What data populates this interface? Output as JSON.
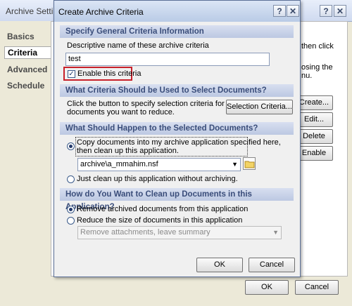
{
  "background_window": {
    "title": "Archive Settin",
    "help_button": "?",
    "close_button": "✕",
    "tabs": [
      "Basics",
      "Criteria",
      "Advanced",
      "Schedule"
    ],
    "snippet_1": "then click",
    "snippet_2": "osing the",
    "snippet_3": "nu.",
    "buttons": {
      "create": "Create...",
      "edit": "Edit...",
      "delete": "Delete",
      "enable": "Enable",
      "ok": "OK",
      "cancel": "Cancel"
    }
  },
  "dialog": {
    "title": "Create Archive Criteria",
    "help_button": "?",
    "close_button": "✕",
    "section_general": "Specify General Criteria Information",
    "name_label": "Descriptive name of these archive criteria",
    "name_value": "test",
    "enable_label": "Enable this criteria",
    "enable_checked": true,
    "section_select": "What Criteria Should be Used to Select Documents?",
    "select_help_1": "Click the button to specify selection criteria for",
    "select_help_2": "documents you want to reduce.",
    "selection_button": "Selection Criteria...",
    "section_happen": "What Should Happen to the Selected Documents?",
    "copy_option_1": "Copy documents into my archive application specified here,",
    "copy_option_2": "then clean up this application.",
    "archive_path": "archive\\a_mmahim.nsf",
    "cleanup_only_option": "Just clean up this application without archiving.",
    "section_cleanup": "How do You Want to Clean up Documents in this Application?",
    "remove_option": "Remove archived documents from this application",
    "reduce_option": "Reduce the size of documents in this application",
    "reduce_select_value": "Remove attachments, leave summary",
    "ok_button": "OK",
    "cancel_button": "Cancel"
  },
  "colors": {
    "section_header_text": "#3a4d7a",
    "highlight_border": "#c8202a"
  }
}
